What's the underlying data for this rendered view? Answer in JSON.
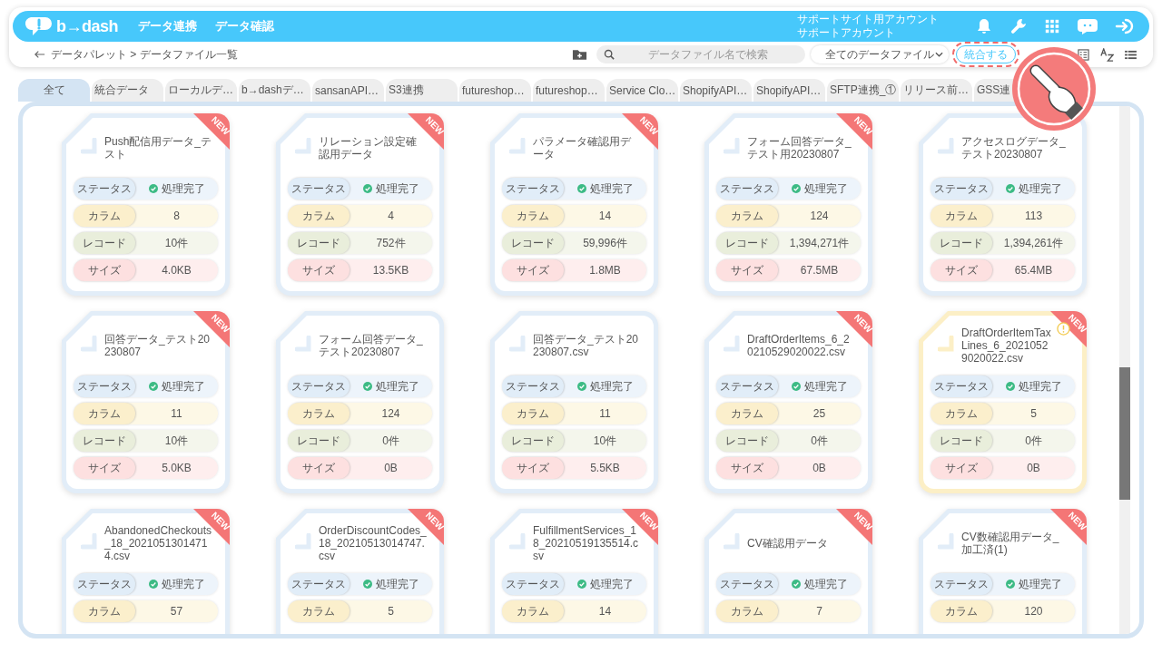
{
  "header": {
    "logo": "b→dash",
    "nav": [
      {
        "label": "データ連携"
      },
      {
        "label": "データ確認"
      }
    ],
    "account": [
      "サポートサイト用アカウント",
      "サポートアカウント"
    ]
  },
  "toolbar": {
    "breadcrumb": "データパレット > データファイル一覧",
    "search": {
      "placeholder": "データファイル名で検索"
    },
    "filter": "全てのデータファイル",
    "merge_button": "統合する"
  },
  "tabs": [
    {
      "label": "全て",
      "selected": true
    },
    {
      "label": "統合データ",
      "selected": false
    },
    {
      "label": "ローカルデ…",
      "selected": false
    },
    {
      "label": "b→dashデ…",
      "selected": false
    },
    {
      "label": "sansanAPI…",
      "selected": false
    },
    {
      "label": "S3連携",
      "selected": false
    },
    {
      "label": "futureshop…",
      "selected": false
    },
    {
      "label": "futureshop…",
      "selected": false
    },
    {
      "label": "Service Clo…",
      "selected": false
    },
    {
      "label": "ShopifyAPI…",
      "selected": false
    },
    {
      "label": "ShopifyAPI…",
      "selected": false
    },
    {
      "label": "SFTP連携_①",
      "selected": false
    },
    {
      "label": "リリース前…",
      "selected": false
    },
    {
      "label": "GSS連",
      "selected": false
    }
  ],
  "files": [
    {
      "name": "Push配信用データ_テスト",
      "badge": "NEW",
      "warning": false,
      "rows": [
        {
          "kind": "status",
          "label": "ステータス",
          "value": "処理完了"
        },
        {
          "kind": "column",
          "label": "カラム",
          "value": "8"
        },
        {
          "kind": "record",
          "label": "レコード",
          "value": "10件"
        },
        {
          "kind": "size",
          "label": "サイズ",
          "value": "4.0KB"
        }
      ]
    },
    {
      "name": "リレーション設定確認用データ",
      "badge": "NEW",
      "warning": false,
      "rows": [
        {
          "kind": "status",
          "label": "ステータス",
          "value": "処理完了"
        },
        {
          "kind": "column",
          "label": "カラム",
          "value": "4"
        },
        {
          "kind": "record",
          "label": "レコード",
          "value": "752件"
        },
        {
          "kind": "size",
          "label": "サイズ",
          "value": "13.5KB"
        }
      ]
    },
    {
      "name": "パラメータ確認用データ",
      "badge": "NEW",
      "warning": false,
      "rows": [
        {
          "kind": "status",
          "label": "ステータス",
          "value": "処理完了"
        },
        {
          "kind": "column",
          "label": "カラム",
          "value": "14"
        },
        {
          "kind": "record",
          "label": "レコード",
          "value": "59,996件"
        },
        {
          "kind": "size",
          "label": "サイズ",
          "value": "1.8MB"
        }
      ]
    },
    {
      "name": "フォーム回答データ_テスト用20230807",
      "badge": "NEW",
      "warning": false,
      "rows": [
        {
          "kind": "status",
          "label": "ステータス",
          "value": "処理完了"
        },
        {
          "kind": "column",
          "label": "カラム",
          "value": "124"
        },
        {
          "kind": "record",
          "label": "レコード",
          "value": "1,394,271件"
        },
        {
          "kind": "size",
          "label": "サイズ",
          "value": "67.5MB"
        }
      ]
    },
    {
      "name": "アクセスログデータ_テスト20230807",
      "warning": false,
      "rows": [
        {
          "kind": "status",
          "label": "ステータス",
          "value": "処理完了"
        },
        {
          "kind": "column",
          "label": "カラム",
          "value": "113"
        },
        {
          "kind": "record",
          "label": "レコード",
          "value": "1,394,261件"
        },
        {
          "kind": "size",
          "label": "サイズ",
          "value": "65.4MB"
        }
      ]
    },
    {
      "name": "回答データ_テスト20230807",
      "badge": "NEW",
      "warning": false,
      "rows": [
        {
          "kind": "status",
          "label": "ステータス",
          "value": "処理完了"
        },
        {
          "kind": "column",
          "label": "カラム",
          "value": "11"
        },
        {
          "kind": "record",
          "label": "レコード",
          "value": "10件"
        },
        {
          "kind": "size",
          "label": "サイズ",
          "value": "5.0KB"
        }
      ]
    },
    {
      "name": "フォーム回答データ_テスト20230807",
      "warning": false,
      "rows": [
        {
          "kind": "status",
          "label": "ステータス",
          "value": "処理完了"
        },
        {
          "kind": "column",
          "label": "カラム",
          "value": "124"
        },
        {
          "kind": "record",
          "label": "レコード",
          "value": "0件"
        },
        {
          "kind": "size",
          "label": "サイズ",
          "value": "0B"
        }
      ]
    },
    {
      "name": "回答データ_テスト20230807.csv",
      "warning": false,
      "rows": [
        {
          "kind": "status",
          "label": "ステータス",
          "value": "処理完了"
        },
        {
          "kind": "column",
          "label": "カラム",
          "value": "11"
        },
        {
          "kind": "record",
          "label": "レコード",
          "value": "10件"
        },
        {
          "kind": "size",
          "label": "サイズ",
          "value": "5.5KB"
        }
      ]
    },
    {
      "name": "DraftOrderItems_6_20210529020022.csv",
      "badge": "NEW",
      "warning": false,
      "rows": [
        {
          "kind": "status",
          "label": "ステータス",
          "value": "処理完了"
        },
        {
          "kind": "column",
          "label": "カラム",
          "value": "25"
        },
        {
          "kind": "record",
          "label": "レコード",
          "value": "0件"
        },
        {
          "kind": "size",
          "label": "サイズ",
          "value": "0B"
        }
      ]
    },
    {
      "name": "DraftOrderItemTaxLines_6_20210529020022.csv",
      "badge": "NEW",
      "warning": true,
      "rows": [
        {
          "kind": "status",
          "label": "ステータス",
          "value": "処理完了"
        },
        {
          "kind": "column",
          "label": "カラム",
          "value": "5"
        },
        {
          "kind": "record",
          "label": "レコード",
          "value": "0件"
        },
        {
          "kind": "size",
          "label": "サイズ",
          "value": "0B"
        }
      ]
    },
    {
      "name": "AbandonedCheckouts_18_20210513014714.csv",
      "badge": "NEW",
      "warning": false,
      "rows": [
        {
          "kind": "status",
          "label": "ステータス",
          "value": "処理完了"
        },
        {
          "kind": "column",
          "label": "カラム",
          "value": "57"
        }
      ]
    },
    {
      "name": "OrderDiscountCodes_18_20210513014747.csv",
      "badge": "NEW",
      "warning": false,
      "rows": [
        {
          "kind": "status",
          "label": "ステータス",
          "value": "処理完了"
        },
        {
          "kind": "column",
          "label": "カラム",
          "value": "5"
        }
      ]
    },
    {
      "name": "FulfillmentServices_18_20210519135514.csv",
      "badge": "NEW",
      "warning": false,
      "rows": [
        {
          "kind": "status",
          "label": "ステータス",
          "value": "処理完了"
        },
        {
          "kind": "column",
          "label": "カラム",
          "value": "14"
        }
      ]
    },
    {
      "name": "CV確認用データ",
      "badge": "NEW",
      "warning": false,
      "rows": [
        {
          "kind": "status",
          "label": "ステータス",
          "value": "処理完了"
        },
        {
          "kind": "column",
          "label": "カラム",
          "value": "7"
        }
      ]
    },
    {
      "name": "CV数確認用データ_加工済(1)",
      "badge": "NEW",
      "warning": false,
      "rows": [
        {
          "kind": "status",
          "label": "ステータス",
          "value": "処理完了"
        },
        {
          "kind": "column",
          "label": "カラム",
          "value": "120"
        }
      ]
    }
  ]
}
